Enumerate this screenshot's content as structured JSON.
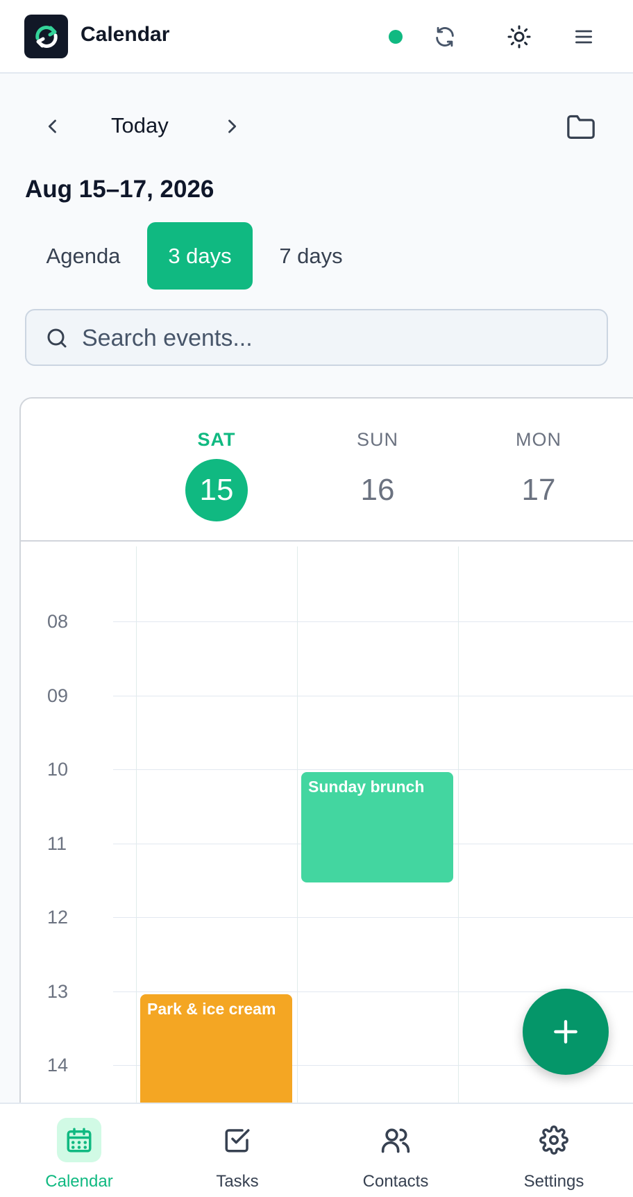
{
  "header": {
    "title": "Calendar",
    "status_color": "#10b981",
    "icons": [
      "sync-icon",
      "theme-toggle-icon",
      "menu-icon"
    ]
  },
  "nav": {
    "today_label": "Today",
    "range_title": "Aug 15–17, 2026"
  },
  "view_tabs": [
    {
      "label": "Agenda",
      "active": false
    },
    {
      "label": "3 days",
      "active": true
    },
    {
      "label": "7 days",
      "active": false
    }
  ],
  "search": {
    "placeholder": "Search events...",
    "value": ""
  },
  "days": [
    {
      "dow": "SAT",
      "num": "15",
      "today": true
    },
    {
      "dow": "SUN",
      "num": "16",
      "today": false
    },
    {
      "dow": "MON",
      "num": "17",
      "today": false
    }
  ],
  "hours": [
    "08",
    "09",
    "10",
    "11",
    "12",
    "13",
    "14"
  ],
  "events": [
    {
      "title": "Sunday brunch",
      "day": "SUN",
      "start": "10:00",
      "end": "11:30",
      "color": "#43d6a0"
    },
    {
      "title": "Park & ice cream",
      "day": "SAT",
      "start": "13:00",
      "end": "",
      "color": "#f4a623"
    }
  ],
  "bottom_nav": [
    {
      "label": "Calendar",
      "icon": "calendar-icon",
      "active": true
    },
    {
      "label": "Tasks",
      "icon": "checkbox-icon",
      "active": false
    },
    {
      "label": "Contacts",
      "icon": "contacts-icon",
      "active": false
    },
    {
      "label": "Settings",
      "icon": "gear-icon",
      "active": false
    }
  ],
  "accent_color": "#10b981"
}
